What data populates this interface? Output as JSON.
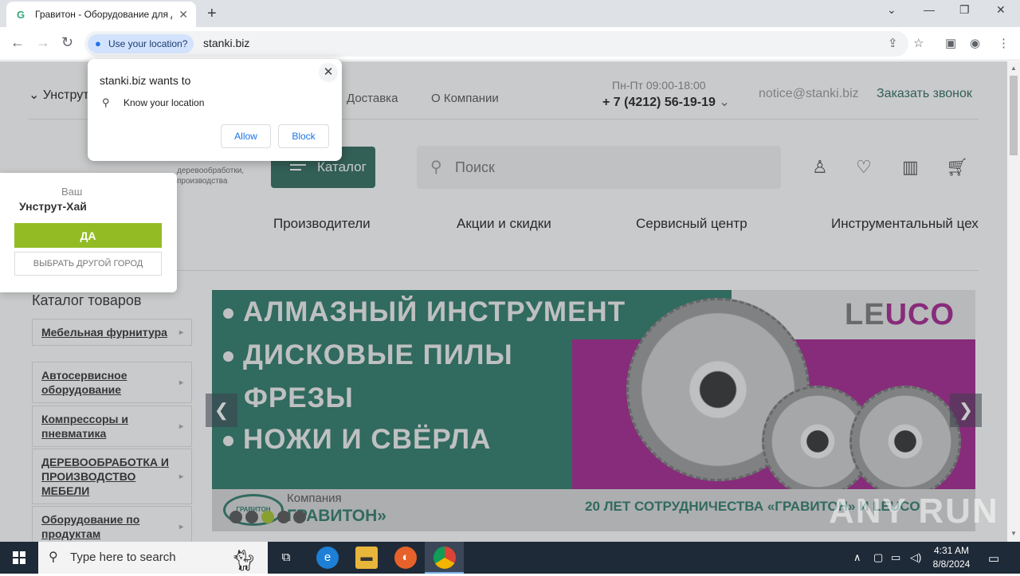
{
  "browser": {
    "tab_title": "Гравитон - Оборудование для д",
    "url": "stanki.biz",
    "location_pill": "Use your location?"
  },
  "permission": {
    "title": "stanki.biz wants to",
    "item": "Know your location",
    "allow": "Allow",
    "block": "Block"
  },
  "header": {
    "city": "Унструт",
    "nav": [
      "Доставка",
      "О Компании"
    ],
    "hours": "Пн-Пт 09:00-18:00",
    "phone": "+ 7 (4212) 56-19-19",
    "email": "notice@stanki.biz",
    "callback": "Заказать звонок",
    "logo_sub": "деревообработки, производства",
    "catalog_btn": "Каталог",
    "search_placeholder": "Поиск"
  },
  "city_popup": {
    "question": "Ваш",
    "city": "Унструт-Хай",
    "yes": "ДА",
    "other": "ВЫБРАТЬ ДРУГОЙ ГОРОД"
  },
  "menu2": [
    "Производители",
    "Акции и скидки",
    "Сервисный центр",
    "Инструментальный цех"
  ],
  "catalog": {
    "title": "Каталог товаров",
    "items": [
      "Мебельная фурнитура",
      "Автосервисное оборудование",
      "Компрессоры и пневматика",
      "ДЕРЕВООБРАБОТКА И ПРОИЗВОДСТВО МЕБЕЛИ",
      "Оборудование по продуктам"
    ]
  },
  "banner": {
    "lines": [
      "АЛМАЗНЫЙ ИНСТРУМЕНТ",
      "ДИСКОВЫЕ ПИЛЫ",
      "ФРЕЗЫ",
      "НОЖИ И СВЁРЛА"
    ],
    "brand_a": "LE",
    "brand_b": "UCO",
    "company_label": "Компания",
    "company": "ГРАВИТОН»",
    "logo_text": "ГРАВИТОН",
    "tagline": "20 ЛЕТ СОТРУДНИЧЕСТВА «ГРАВИТОН» И LEUCO",
    "slides": 5,
    "active_slide": 3
  },
  "watermark": "ANY RUN",
  "taskbar": {
    "search_placeholder": "Type here to search",
    "time": "4:31 AM",
    "date": "8/8/2024"
  },
  "colors": {
    "brand_green": "#2e6b5e",
    "accent_lime": "#93bc24",
    "banner_purple": "#a4248f",
    "banner_teal": "#2d7a6a"
  }
}
